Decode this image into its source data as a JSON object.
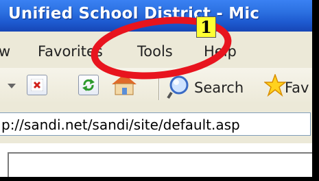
{
  "window": {
    "title": "Unified School District - Mic"
  },
  "menu": {
    "items": [
      {
        "label": "w"
      },
      {
        "label": "Favorites"
      },
      {
        "label": "Tools"
      },
      {
        "label": "Help"
      }
    ]
  },
  "toolbar": {
    "search_label": "Search",
    "favorites_label": "Fav"
  },
  "address": {
    "value": "p://sandi.net/sandi/site/default.asp"
  },
  "annotation": {
    "step_number": "1"
  }
}
